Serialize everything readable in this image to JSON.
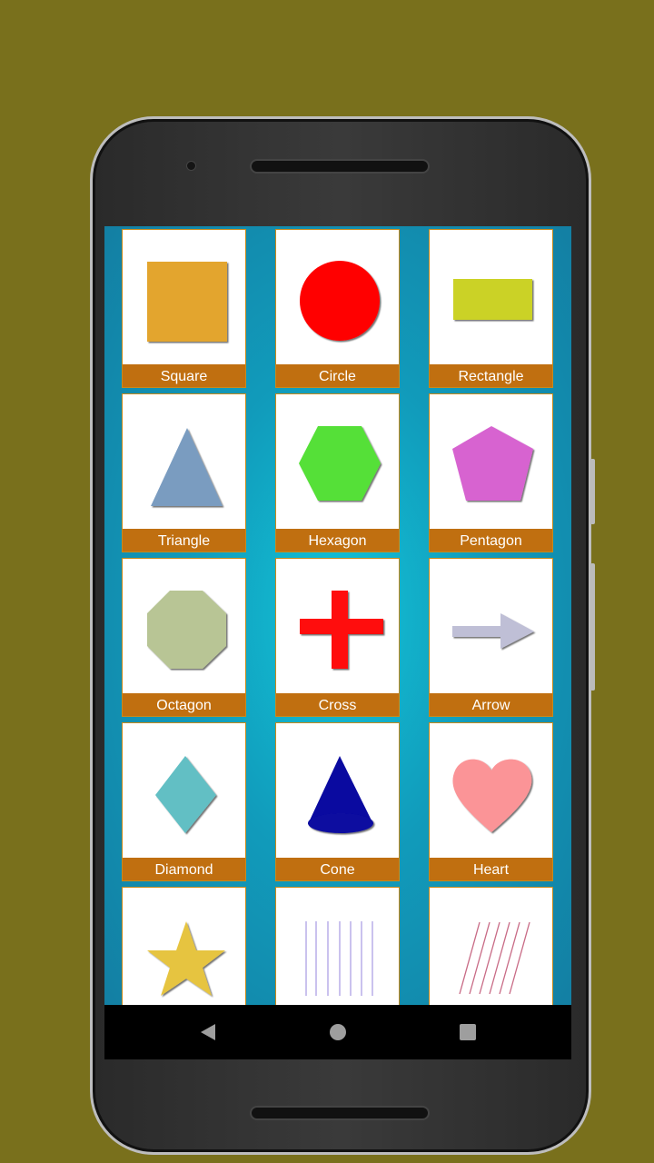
{
  "app": {
    "shapes": [
      {
        "label": "Square",
        "shape": "square",
        "color": "#e3a52f"
      },
      {
        "label": "Circle",
        "shape": "circle",
        "color": "#ff0000"
      },
      {
        "label": "Rectangle",
        "shape": "rectangle",
        "color": "#cbd225"
      },
      {
        "label": "Triangle",
        "shape": "triangle",
        "color": "#7a9cc0"
      },
      {
        "label": "Hexagon",
        "shape": "hexagon",
        "color": "#55e037"
      },
      {
        "label": "Pentagon",
        "shape": "pentagon",
        "color": "#d764d0"
      },
      {
        "label": "Octagon",
        "shape": "octagon",
        "color": "#b8c595"
      },
      {
        "label": "Cross",
        "shape": "cross",
        "color": "#ff0d0d"
      },
      {
        "label": "Arrow",
        "shape": "arrow",
        "color": "#bfbfd6"
      },
      {
        "label": "Diamond",
        "shape": "diamond",
        "color": "#62bfc4"
      },
      {
        "label": "Cone",
        "shape": "cone",
        "color": "#0a0aa0"
      },
      {
        "label": "Heart",
        "shape": "heart",
        "color": "#fb9497"
      },
      {
        "label": "",
        "shape": "star",
        "color": "#e6c440"
      },
      {
        "label": "",
        "shape": "vertical-lines",
        "color": "#b9aee8"
      },
      {
        "label": "",
        "shape": "slanted-lines",
        "color": "#c86a85"
      }
    ]
  },
  "navbar": {
    "back": "back-icon",
    "home": "home-icon",
    "recents": "recents-icon"
  }
}
